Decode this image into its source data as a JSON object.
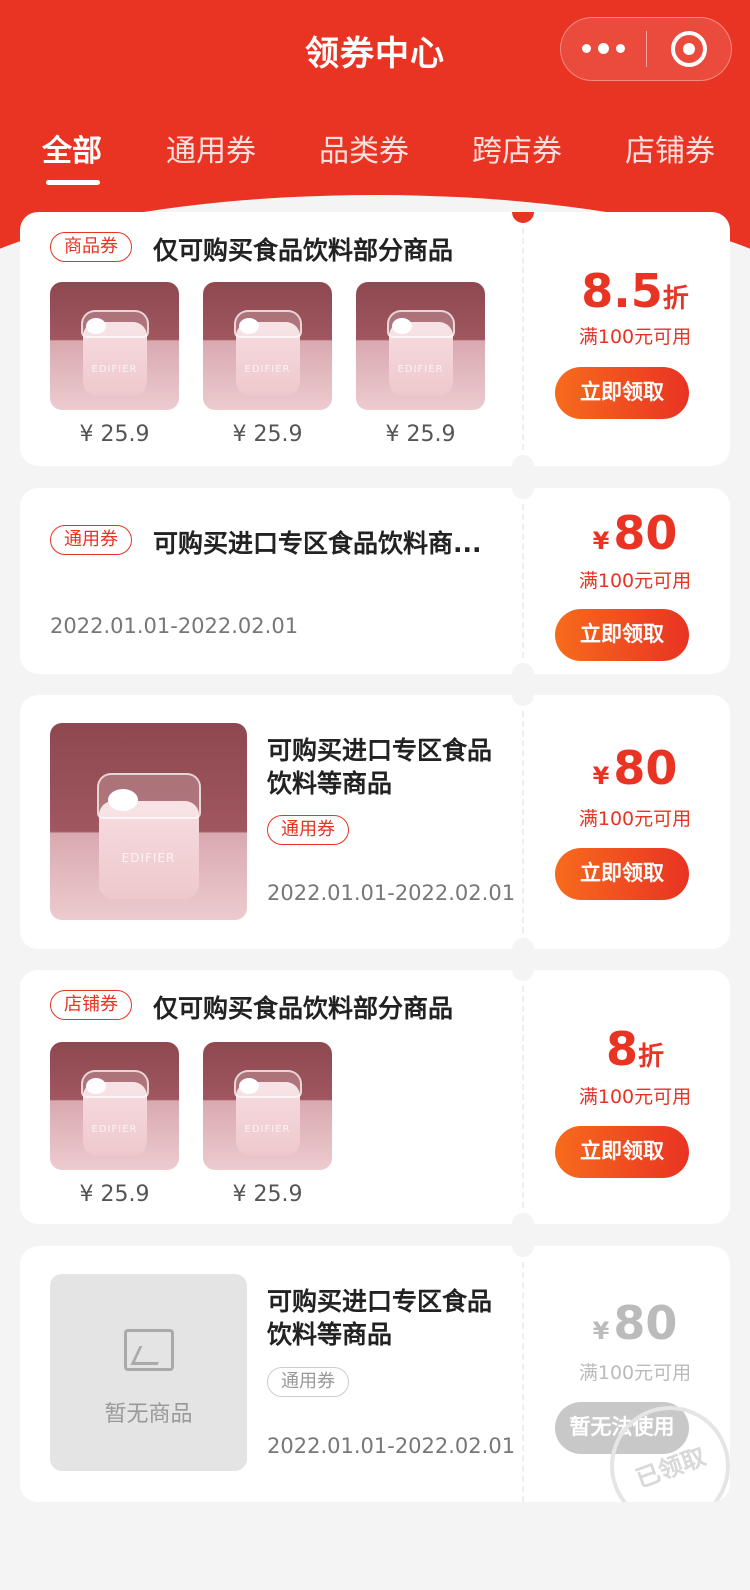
{
  "header": {
    "title": "领券中心"
  },
  "tabs": [
    {
      "label": "全部"
    },
    {
      "label": "通用券"
    },
    {
      "label": "品类券"
    },
    {
      "label": "跨店券"
    },
    {
      "label": "店铺券"
    }
  ],
  "active_tab": "全部",
  "colors": {
    "accent": "#e93323",
    "button_start": "#f76b1c",
    "disabled": "#c8c8c8",
    "page_bg": "#f4f4f4"
  },
  "coupons": [
    {
      "tag": "商品券",
      "title": "仅可购买食品饮料部分商品",
      "products": [
        {
          "price": "¥ 25.9"
        },
        {
          "price": "¥ 25.9"
        },
        {
          "price": "¥ 25.9"
        }
      ],
      "value_num": "8.5",
      "value_unit": "折",
      "condition": "满100元可用",
      "button": "立即领取"
    },
    {
      "tag": "通用券",
      "title": "可购买进口专区食品饮料商...",
      "date": "2022.01.01-2022.02.01",
      "value_symbol": "¥",
      "value_num": "80",
      "condition": "满100元可用",
      "button": "立即领取"
    },
    {
      "title_line1": "可购买进口专区食品",
      "title_line2": "饮料等商品",
      "tag": "通用券",
      "date": "2022.01.01-2022.02.01",
      "value_symbol": "¥",
      "value_num": "80",
      "condition": "满100元可用",
      "button": "立即领取"
    },
    {
      "tag": "店铺券",
      "title": "仅可购买食品饮料部分商品",
      "products": [
        {
          "price": "¥ 25.9"
        },
        {
          "price": "¥ 25.9"
        }
      ],
      "value_num": "8",
      "value_unit": "折",
      "condition": "满100元可用",
      "button": "立即领取"
    },
    {
      "no_product_text": "暂无商品",
      "title_line1": "可购买进口专区食品",
      "title_line2": "饮料等商品",
      "tag": "通用券",
      "date": "2022.01.01-2022.02.01",
      "value_symbol": "¥",
      "value_num": "80",
      "condition": "满100元可用",
      "button": "暂无法使用",
      "stamp": "已领取"
    }
  ],
  "product_brand": "EDIFIER"
}
